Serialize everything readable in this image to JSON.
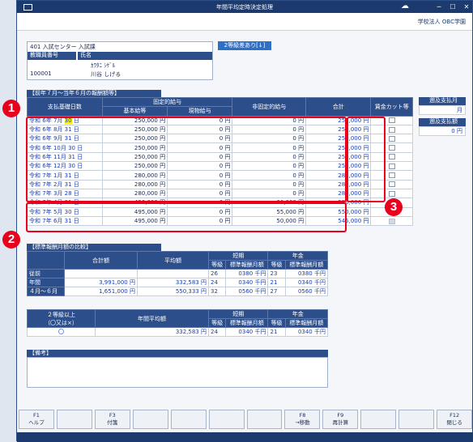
{
  "window": {
    "title": "年間平均定時決定処理",
    "company": "学校法人 OBC学園"
  },
  "header": {
    "center_code": "401 入試センター 入試課",
    "staff_no_label": "教職員番号",
    "name_label": "氏名",
    "staff_no": "100001",
    "name_kana": "ｶﾜﾀﾆ ｼｹﾞﾙ",
    "name": "川谷 しげる",
    "grade_btn": "2等級差あり[↓]"
  },
  "remuneration": {
    "section_title": "【前年７月～当年６月の報酬額等】",
    "headers": {
      "days": "支払基礎日数",
      "fixed": "固定的給与",
      "basic": "基本給等",
      "inkind": "現物給与",
      "nonfixed": "非固定的給与",
      "total": "合計",
      "cut": "賃金カット等"
    },
    "unit_yen": "円",
    "unit_day": "日",
    "rows": [
      {
        "era": "令和",
        "y": "6年",
        "m": "7月",
        "d": "30",
        "basic": "250,000",
        "inkind": "0",
        "nonfixed": "0",
        "total": "250,000"
      },
      {
        "era": "令和",
        "y": "6年",
        "m": "8月",
        "d": "31",
        "basic": "250,000",
        "inkind": "0",
        "nonfixed": "0",
        "total": "250,000"
      },
      {
        "era": "令和",
        "y": "6年",
        "m": "9月",
        "d": "31",
        "basic": "250,000",
        "inkind": "0",
        "nonfixed": "0",
        "total": "250,000"
      },
      {
        "era": "令和",
        "y": "6年",
        "m": "10月",
        "d": "30",
        "basic": "250,000",
        "inkind": "0",
        "nonfixed": "0",
        "total": "250,000"
      },
      {
        "era": "令和",
        "y": "6年",
        "m": "11月",
        "d": "31",
        "basic": "250,000",
        "inkind": "0",
        "nonfixed": "0",
        "total": "250,000"
      },
      {
        "era": "令和",
        "y": "6年",
        "m": "12月",
        "d": "30",
        "basic": "250,000",
        "inkind": "0",
        "nonfixed": "0",
        "total": "250,000"
      },
      {
        "era": "令和",
        "y": "7年",
        "m": "1月",
        "d": "31",
        "basic": "280,000",
        "inkind": "0",
        "nonfixed": "0",
        "total": "280,000"
      },
      {
        "era": "令和",
        "y": "7年",
        "m": "2月",
        "d": "31",
        "basic": "280,000",
        "inkind": "0",
        "nonfixed": "0",
        "total": "280,000"
      },
      {
        "era": "令和",
        "y": "7年",
        "m": "3月",
        "d": "28",
        "basic": "280,000",
        "inkind": "0",
        "nonfixed": "0",
        "total": "280,000"
      },
      {
        "era": "令和",
        "y": "7年",
        "m": "4月",
        "d": "31",
        "basic": "496,000",
        "inkind": "0",
        "nonfixed": "60,000",
        "total": "556,000"
      },
      {
        "era": "令和",
        "y": "7年",
        "m": "5月",
        "d": "30",
        "basic": "495,000",
        "inkind": "0",
        "nonfixed": "55,000",
        "total": "550,000"
      },
      {
        "era": "令和",
        "y": "7年",
        "m": "6月",
        "d": "31",
        "basic": "495,000",
        "inkind": "0",
        "nonfixed": "50,000",
        "total": "545,000"
      }
    ]
  },
  "retro": {
    "month_label": "遡及支払月",
    "month_unit": "月",
    "amount_label": "遡及支払額",
    "amount": "0",
    "amount_unit": "円"
  },
  "compare": {
    "section_title": "【標準報酬月額の比較】",
    "h_total": "合計額",
    "h_avg": "平均額",
    "h_short": "短期",
    "h_pension": "年金",
    "h_grade": "等級",
    "h_std": "標準報酬月額",
    "rows": [
      {
        "label": "従前",
        "total": "",
        "avg": "",
        "sg": "26",
        "sstd": "0380",
        "pg": "23",
        "pstd": "0380"
      },
      {
        "label": "年間",
        "total": "3,991,000",
        "avg": "332,583",
        "sg": "24",
        "sstd": "0340",
        "pg": "21",
        "pstd": "0340"
      },
      {
        "label": "４月～６月",
        "total": "1,651,000",
        "avg": "550,333",
        "sg": "32",
        "sstd": "0560",
        "pg": "27",
        "pstd": "0560"
      }
    ],
    "unit_yen": "円",
    "unit_k": "千円"
  },
  "grade": {
    "h1": "２等級以上",
    "h2": "（〇又は×）",
    "mark": "〇",
    "h_avg": "年間平均額",
    "avg": "332,583",
    "sg": "24",
    "sstd": "0340",
    "pg": "21",
    "pstd": "0340"
  },
  "memo": {
    "title": "【備考】"
  },
  "fkeys": [
    {
      "key": "F1",
      "label": "ヘルプ"
    },
    {
      "key": "",
      "label": ""
    },
    {
      "key": "F3",
      "label": "付箋"
    },
    {
      "key": "",
      "label": ""
    },
    {
      "key": "",
      "label": ""
    },
    {
      "key": "",
      "label": ""
    },
    {
      "key": "",
      "label": ""
    },
    {
      "key": "F8",
      "label": "→移動"
    },
    {
      "key": "F9",
      "label": "再計算"
    },
    {
      "key": "",
      "label": ""
    },
    {
      "key": "",
      "label": ""
    },
    {
      "key": "F12",
      "label": "閉じる"
    }
  ],
  "badges": [
    "1",
    "2",
    "3"
  ]
}
